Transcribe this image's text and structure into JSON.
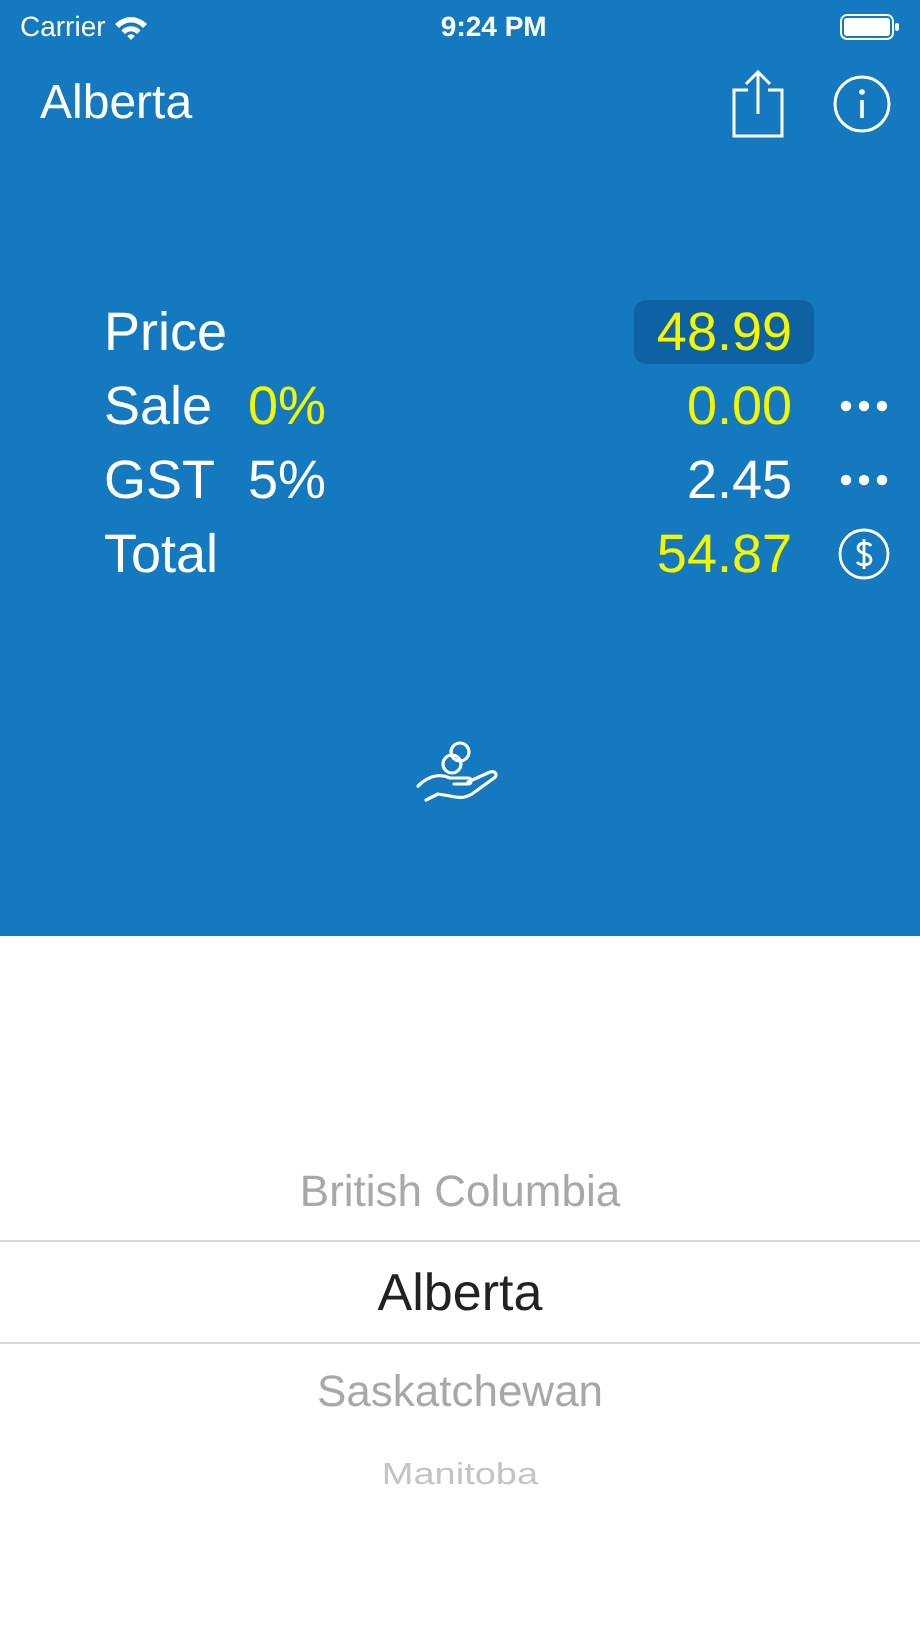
{
  "status_bar": {
    "carrier": "Carrier",
    "time": "9:24 PM"
  },
  "header": {
    "title": "Alberta"
  },
  "rows": [
    {
      "label": "Price",
      "value": "48.99",
      "value_highlight": true,
      "focused": true,
      "kind": "plain"
    },
    {
      "label": "Sale",
      "rate": "0%",
      "rate_highlight": true,
      "value": "0.00",
      "value_highlight": true,
      "focused": false,
      "kind": "more"
    },
    {
      "label": "GST",
      "rate": "5%",
      "rate_highlight": false,
      "value": "2.45",
      "value_highlight": false,
      "focused": false,
      "kind": "more"
    },
    {
      "label": "Total",
      "value": "54.87",
      "value_highlight": true,
      "focused": false,
      "kind": "dollar"
    }
  ],
  "picker": [
    {
      "label": "British Columbia",
      "selected": false
    },
    {
      "label": "Alberta",
      "selected": true
    },
    {
      "label": "Saskatchewan",
      "selected": false
    },
    {
      "label": "Manitoba",
      "selected": false
    }
  ]
}
